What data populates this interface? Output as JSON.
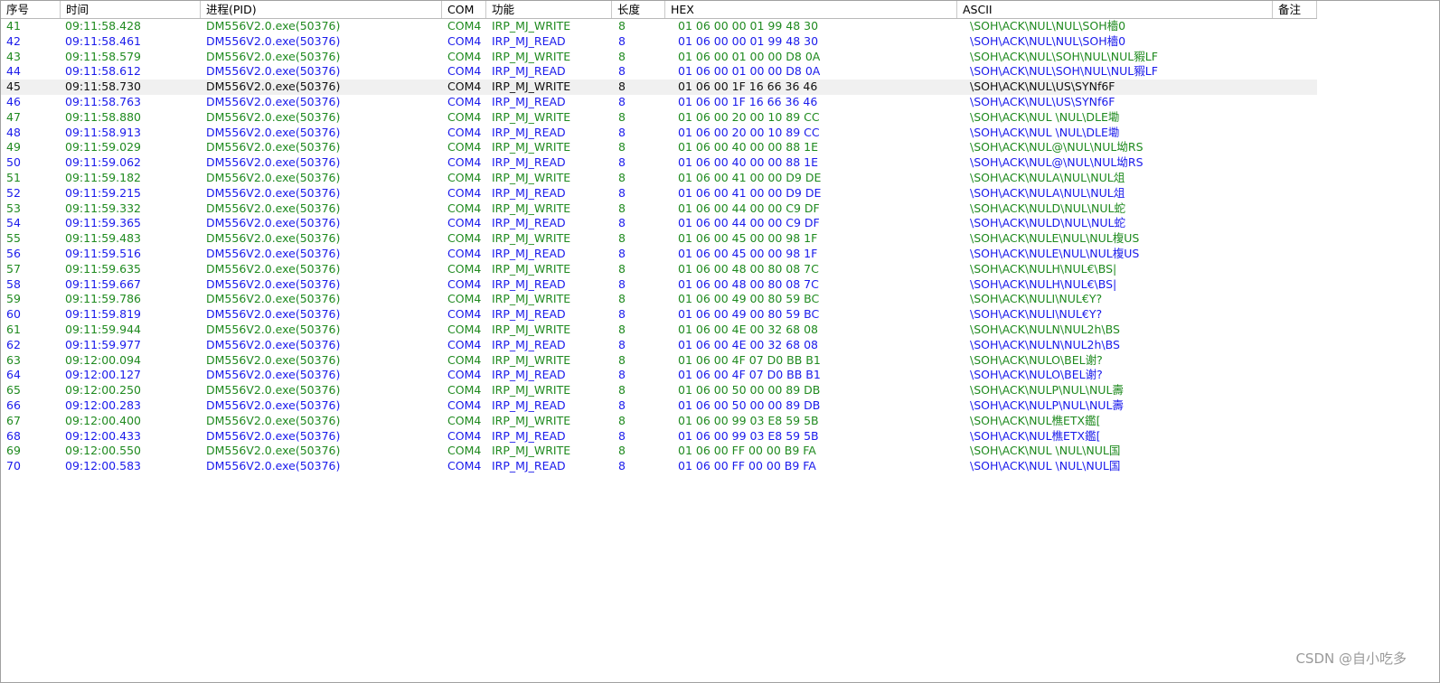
{
  "headers": [
    "序号",
    "时间",
    "进程(PID)",
    "COM",
    "功能",
    "长度",
    "HEX",
    "ASCII",
    "备注"
  ],
  "selected_seq": "45",
  "colors": {
    "write": "#1f8a1f",
    "read": "#1a1aeb",
    "selected_bg": "#f0f0f0"
  },
  "rows": [
    {
      "seq": "41",
      "time": "09:11:58.428",
      "proc": "DM556V2.0.exe(50376)",
      "com": "COM4",
      "func": "IRP_MJ_WRITE",
      "len": "8",
      "hex": "01 06 00 00 01 99 48 30",
      "ascii": "\\SOH\\ACK\\NUL\\NUL\\SOH檣0"
    },
    {
      "seq": "42",
      "time": "09:11:58.461",
      "proc": "DM556V2.0.exe(50376)",
      "com": "COM4",
      "func": "IRP_MJ_READ",
      "len": "8",
      "hex": "01 06 00 00 01 99 48 30",
      "ascii": "\\SOH\\ACK\\NUL\\NUL\\SOH檣0"
    },
    {
      "seq": "43",
      "time": "09:11:58.579",
      "proc": "DM556V2.0.exe(50376)",
      "com": "COM4",
      "func": "IRP_MJ_WRITE",
      "len": "8",
      "hex": "01 06 00 01 00 00 D8 0A",
      "ascii": "\\SOH\\ACK\\NUL\\SOH\\NUL\\NUL豭LF"
    },
    {
      "seq": "44",
      "time": "09:11:58.612",
      "proc": "DM556V2.0.exe(50376)",
      "com": "COM4",
      "func": "IRP_MJ_READ",
      "len": "8",
      "hex": "01 06 00 01 00 00 D8 0A",
      "ascii": "\\SOH\\ACK\\NUL\\SOH\\NUL\\NUL豭LF"
    },
    {
      "seq": "45",
      "time": "09:11:58.730",
      "proc": "DM556V2.0.exe(50376)",
      "com": "COM4",
      "func": "IRP_MJ_WRITE",
      "len": "8",
      "hex": "01 06 00 1F 16 66 36 46",
      "ascii": "\\SOH\\ACK\\NUL\\US\\SYNf6F"
    },
    {
      "seq": "46",
      "time": "09:11:58.763",
      "proc": "DM556V2.0.exe(50376)",
      "com": "COM4",
      "func": "IRP_MJ_READ",
      "len": "8",
      "hex": "01 06 00 1F 16 66 36 46",
      "ascii": "\\SOH\\ACK\\NUL\\US\\SYNf6F"
    },
    {
      "seq": "47",
      "time": "09:11:58.880",
      "proc": "DM556V2.0.exe(50376)",
      "com": "COM4",
      "func": "IRP_MJ_WRITE",
      "len": "8",
      "hex": "01 06 00 20 00 10 89 CC",
      "ascii": "\\SOH\\ACK\\NUL \\NUL\\DLE墈"
    },
    {
      "seq": "48",
      "time": "09:11:58.913",
      "proc": "DM556V2.0.exe(50376)",
      "com": "COM4",
      "func": "IRP_MJ_READ",
      "len": "8",
      "hex": "01 06 00 20 00 10 89 CC",
      "ascii": "\\SOH\\ACK\\NUL \\NUL\\DLE墈"
    },
    {
      "seq": "49",
      "time": "09:11:59.029",
      "proc": "DM556V2.0.exe(50376)",
      "com": "COM4",
      "func": "IRP_MJ_WRITE",
      "len": "8",
      "hex": "01 06 00 40 00 00 88 1E",
      "ascii": "\\SOH\\ACK\\NUL@\\NUL\\NUL坳RS"
    },
    {
      "seq": "50",
      "time": "09:11:59.062",
      "proc": "DM556V2.0.exe(50376)",
      "com": "COM4",
      "func": "IRP_MJ_READ",
      "len": "8",
      "hex": "01 06 00 40 00 00 88 1E",
      "ascii": "\\SOH\\ACK\\NUL@\\NUL\\NUL坳RS"
    },
    {
      "seq": "51",
      "time": "09:11:59.182",
      "proc": "DM556V2.0.exe(50376)",
      "com": "COM4",
      "func": "IRP_MJ_WRITE",
      "len": "8",
      "hex": "01 06 00 41 00 00 D9 DE",
      "ascii": "\\SOH\\ACK\\NULA\\NUL\\NUL俎"
    },
    {
      "seq": "52",
      "time": "09:11:59.215",
      "proc": "DM556V2.0.exe(50376)",
      "com": "COM4",
      "func": "IRP_MJ_READ",
      "len": "8",
      "hex": "01 06 00 41 00 00 D9 DE",
      "ascii": "\\SOH\\ACK\\NULA\\NUL\\NUL俎"
    },
    {
      "seq": "53",
      "time": "09:11:59.332",
      "proc": "DM556V2.0.exe(50376)",
      "com": "COM4",
      "func": "IRP_MJ_WRITE",
      "len": "8",
      "hex": "01 06 00 44 00 00 C9 DF",
      "ascii": "\\SOH\\ACK\\NULD\\NUL\\NUL蛇"
    },
    {
      "seq": "54",
      "time": "09:11:59.365",
      "proc": "DM556V2.0.exe(50376)",
      "com": "COM4",
      "func": "IRP_MJ_READ",
      "len": "8",
      "hex": "01 06 00 44 00 00 C9 DF",
      "ascii": "\\SOH\\ACK\\NULD\\NUL\\NUL蛇"
    },
    {
      "seq": "55",
      "time": "09:11:59.483",
      "proc": "DM556V2.0.exe(50376)",
      "com": "COM4",
      "func": "IRP_MJ_WRITE",
      "len": "8",
      "hex": "01 06 00 45 00 00 98 1F",
      "ascii": "\\SOH\\ACK\\NULE\\NUL\\NUL椱US"
    },
    {
      "seq": "56",
      "time": "09:11:59.516",
      "proc": "DM556V2.0.exe(50376)",
      "com": "COM4",
      "func": "IRP_MJ_READ",
      "len": "8",
      "hex": "01 06 00 45 00 00 98 1F",
      "ascii": "\\SOH\\ACK\\NULE\\NUL\\NUL椱US"
    },
    {
      "seq": "57",
      "time": "09:11:59.635",
      "proc": "DM556V2.0.exe(50376)",
      "com": "COM4",
      "func": "IRP_MJ_WRITE",
      "len": "8",
      "hex": "01 06 00 48 00 80 08 7C",
      "ascii": "\\SOH\\ACK\\NULH\\NUL€\\BS|"
    },
    {
      "seq": "58",
      "time": "09:11:59.667",
      "proc": "DM556V2.0.exe(50376)",
      "com": "COM4",
      "func": "IRP_MJ_READ",
      "len": "8",
      "hex": "01 06 00 48 00 80 08 7C",
      "ascii": "\\SOH\\ACK\\NULH\\NUL€\\BS|"
    },
    {
      "seq": "59",
      "time": "09:11:59.786",
      "proc": "DM556V2.0.exe(50376)",
      "com": "COM4",
      "func": "IRP_MJ_WRITE",
      "len": "8",
      "hex": "01 06 00 49 00 80 59 BC",
      "ascii": "\\SOH\\ACK\\NULI\\NUL€Y?"
    },
    {
      "seq": "60",
      "time": "09:11:59.819",
      "proc": "DM556V2.0.exe(50376)",
      "com": "COM4",
      "func": "IRP_MJ_READ",
      "len": "8",
      "hex": "01 06 00 49 00 80 59 BC",
      "ascii": "\\SOH\\ACK\\NULI\\NUL€Y?"
    },
    {
      "seq": "61",
      "time": "09:11:59.944",
      "proc": "DM556V2.0.exe(50376)",
      "com": "COM4",
      "func": "IRP_MJ_WRITE",
      "len": "8",
      "hex": "01 06 00 4E 00 32 68 08",
      "ascii": "\\SOH\\ACK\\NULN\\NUL2h\\BS"
    },
    {
      "seq": "62",
      "time": "09:11:59.977",
      "proc": "DM556V2.0.exe(50376)",
      "com": "COM4",
      "func": "IRP_MJ_READ",
      "len": "8",
      "hex": "01 06 00 4E 00 32 68 08",
      "ascii": "\\SOH\\ACK\\NULN\\NUL2h\\BS"
    },
    {
      "seq": "63",
      "time": "09:12:00.094",
      "proc": "DM556V2.0.exe(50376)",
      "com": "COM4",
      "func": "IRP_MJ_WRITE",
      "len": "8",
      "hex": "01 06 00 4F 07 D0 BB B1",
      "ascii": "\\SOH\\ACK\\NULO\\BEL谢?"
    },
    {
      "seq": "64",
      "time": "09:12:00.127",
      "proc": "DM556V2.0.exe(50376)",
      "com": "COM4",
      "func": "IRP_MJ_READ",
      "len": "8",
      "hex": "01 06 00 4F 07 D0 BB B1",
      "ascii": "\\SOH\\ACK\\NULO\\BEL谢?"
    },
    {
      "seq": "65",
      "time": "09:12:00.250",
      "proc": "DM556V2.0.exe(50376)",
      "com": "COM4",
      "func": "IRP_MJ_WRITE",
      "len": "8",
      "hex": "01 06 00 50 00 00 89 DB",
      "ascii": "\\SOH\\ACK\\NULP\\NUL\\NUL壽"
    },
    {
      "seq": "66",
      "time": "09:12:00.283",
      "proc": "DM556V2.0.exe(50376)",
      "com": "COM4",
      "func": "IRP_MJ_READ",
      "len": "8",
      "hex": "01 06 00 50 00 00 89 DB",
      "ascii": "\\SOH\\ACK\\NULP\\NUL\\NUL壽"
    },
    {
      "seq": "67",
      "time": "09:12:00.400",
      "proc": "DM556V2.0.exe(50376)",
      "com": "COM4",
      "func": "IRP_MJ_WRITE",
      "len": "8",
      "hex": "01 06 00 99 03 E8 59 5B",
      "ascii": "\\SOH\\ACK\\NUL樵ETX鑑["
    },
    {
      "seq": "68",
      "time": "09:12:00.433",
      "proc": "DM556V2.0.exe(50376)",
      "com": "COM4",
      "func": "IRP_MJ_READ",
      "len": "8",
      "hex": "01 06 00 99 03 E8 59 5B",
      "ascii": "\\SOH\\ACK\\NUL樵ETX鑑["
    },
    {
      "seq": "69",
      "time": "09:12:00.550",
      "proc": "DM556V2.0.exe(50376)",
      "com": "COM4",
      "func": "IRP_MJ_WRITE",
      "len": "8",
      "hex": "01 06 00 FF 00 00 B9 FA",
      "ascii": "\\SOH\\ACK\\NUL    \\NUL\\NUL国"
    },
    {
      "seq": "70",
      "time": "09:12:00.583",
      "proc": "DM556V2.0.exe(50376)",
      "com": "COM4",
      "func": "IRP_MJ_READ",
      "len": "8",
      "hex": "01 06 00 FF 00 00 B9 FA",
      "ascii": "\\SOH\\ACK\\NUL    \\NUL\\NUL国"
    }
  ],
  "watermark": "CSDN @自小吃多"
}
